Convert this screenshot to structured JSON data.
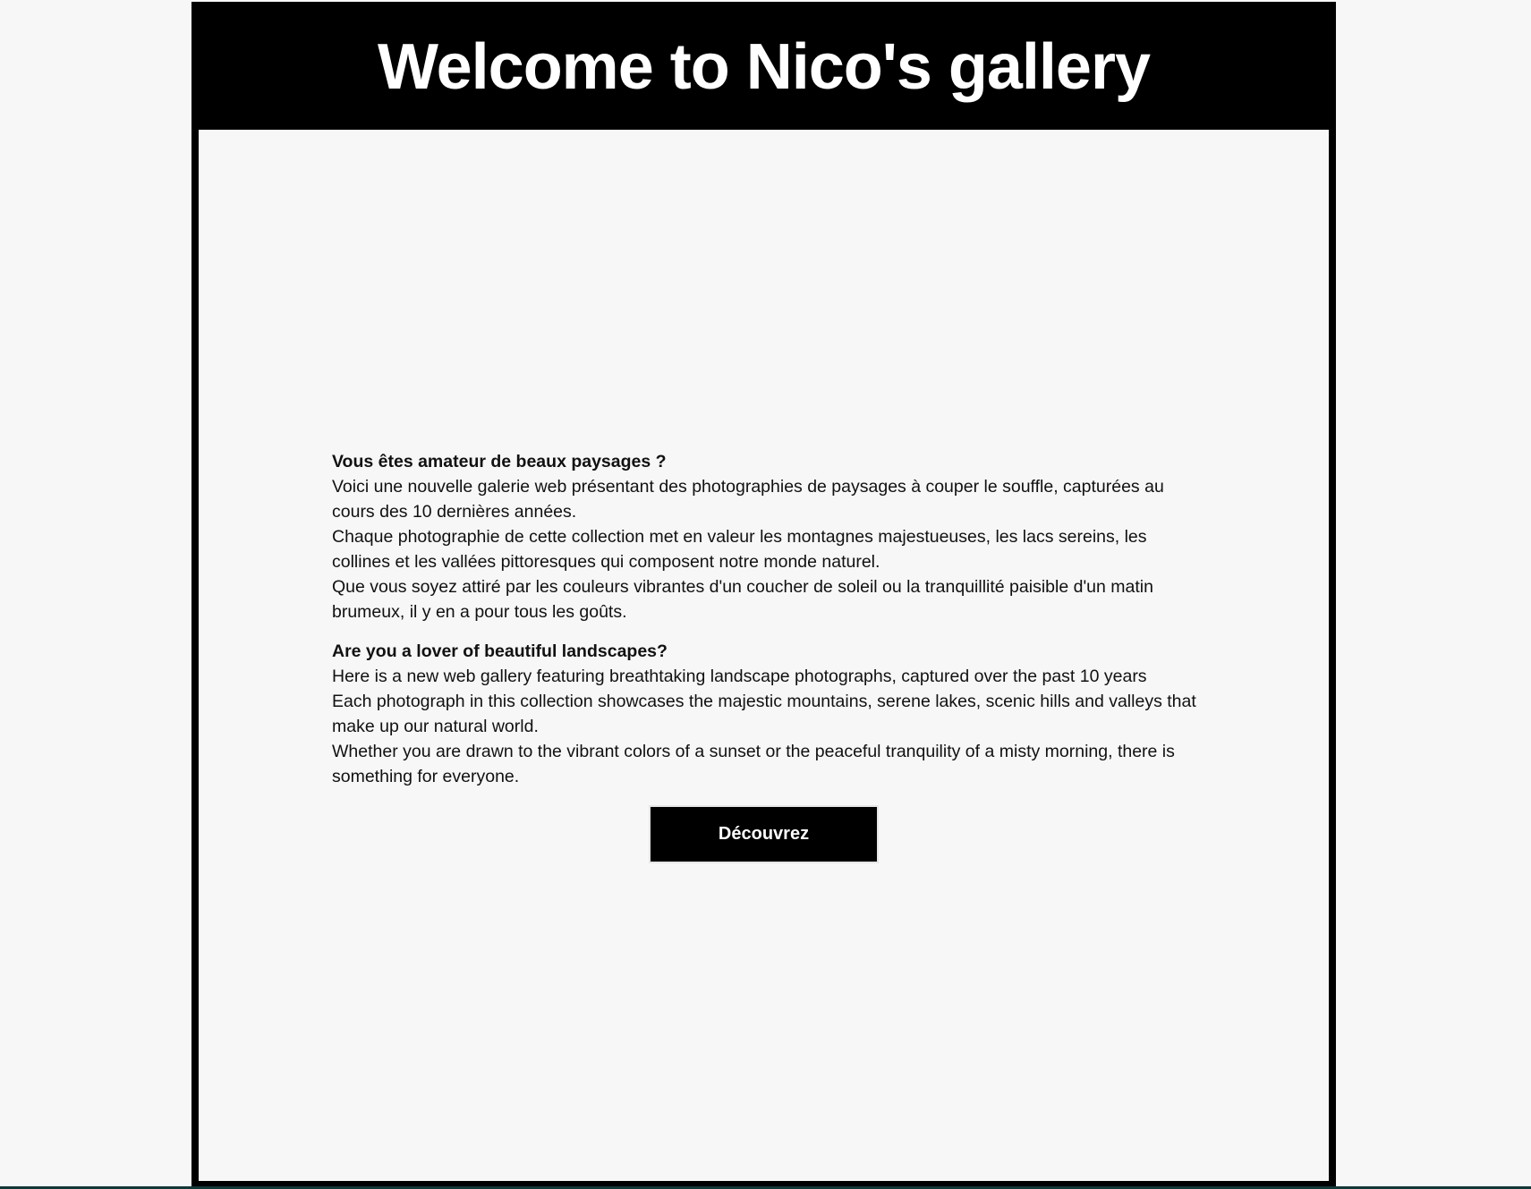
{
  "header": {
    "title": "Welcome to Nico's gallery"
  },
  "intro_fr": {
    "heading": "Vous êtes amateur de beaux paysages ?",
    "paragraphs": [
      "Voici une nouvelle galerie web présentant des photographies de paysages à couper le souffle, capturées au cours des 10 dernières années.",
      "Chaque photographie de cette collection met en valeur les montagnes majestueuses, les lacs sereins, les collines et les vallées pittoresques qui composent notre monde naturel.",
      "Que vous soyez attiré par les couleurs vibrantes d'un coucher de soleil ou la tranquillité paisible d'un matin brumeux, il y en a pour tous les goûts."
    ]
  },
  "intro_en": {
    "heading": "Are you a lover of beautiful landscapes?",
    "paragraphs": [
      "Here is a new web gallery featuring breathtaking landscape photographs, captured over the past 10 years",
      "Each photograph in this collection showcases the majestic mountains, serene lakes, scenic hills and valleys that make up our natural world.",
      "Whether you are drawn to the vibrant colors of a sunset or the peaceful tranquility of a misty morning, there is something for everyone."
    ]
  },
  "cta": {
    "label": "Découvrez"
  },
  "colors": {
    "frame": "#000000",
    "panel": "#f7f7f7",
    "text": "#111111"
  }
}
